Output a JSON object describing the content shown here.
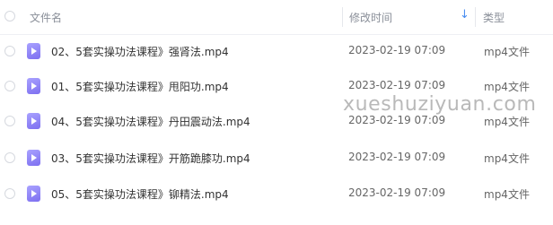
{
  "header": {
    "name_label": "文件名",
    "time_label": "修改时间",
    "type_label": "类型",
    "sort_icon": "arrow-down-icon"
  },
  "files": [
    {
      "name": "02、5套实操功法课程》强肾法.mp4",
      "time": "2023-02-19 07:09",
      "type": "mp4文件"
    },
    {
      "name": "01、5套实操功法课程》甩阳功.mp4",
      "time": "2023-02-19 07:09",
      "type": "mp4文件"
    },
    {
      "name": "04、5套实操功法课程》丹田震动法.mp4",
      "time": "2023-02-19 07:09",
      "type": "mp4文件"
    },
    {
      "name": "03、5套实操功法课程》开筋跪膝功.mp4",
      "time": "2023-02-19 07:09",
      "type": "mp4文件"
    },
    {
      "name": "05、5套实操功法课程》铆精法.mp4",
      "time": "2023-02-19 07:09",
      "type": "mp4文件"
    }
  ],
  "watermark": "xueshuziyuan.com",
  "colors": {
    "accent": "#4a8ef0",
    "file_icon": "#8b7ff5"
  }
}
